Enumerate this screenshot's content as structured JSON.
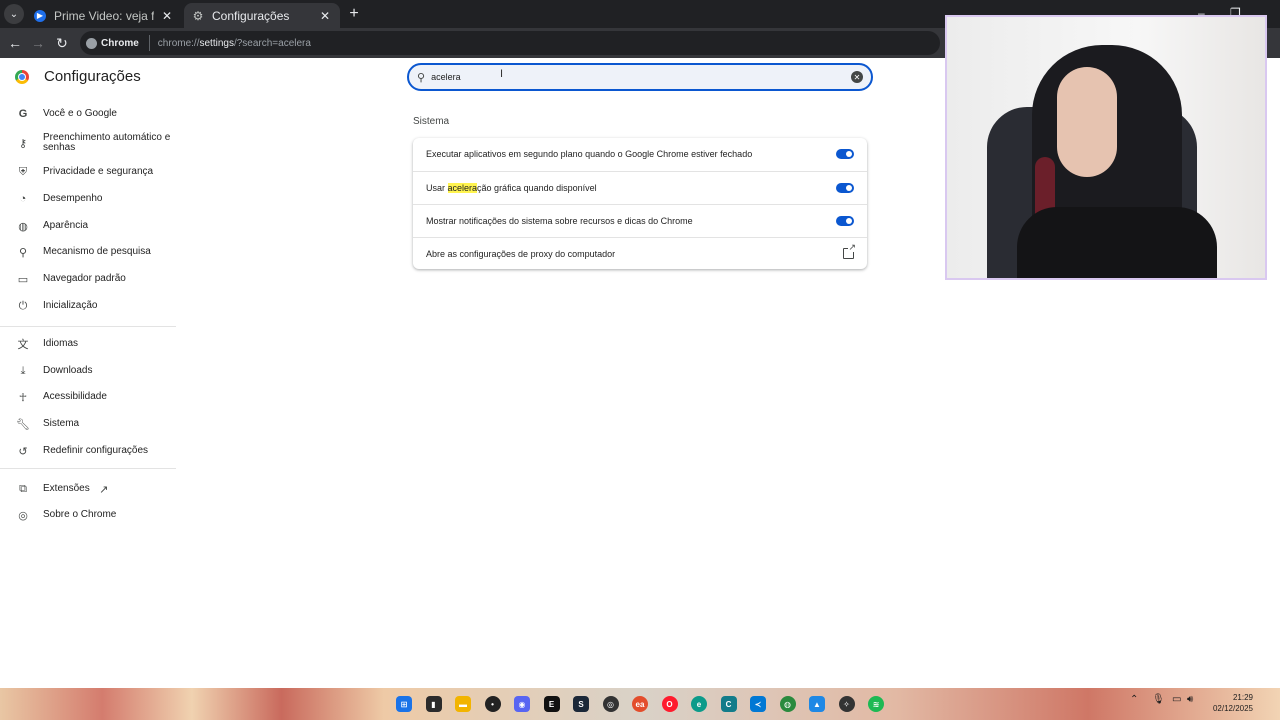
{
  "browser": {
    "tabs": [
      {
        "title": "Prime Video: veja filmes, séries,",
        "active": false
      },
      {
        "title": "Configurações",
        "active": true
      }
    ],
    "chip_label": "Chrome",
    "url_prefix": "chrome://",
    "url_host": "settings",
    "url_rest": "/?search=acelera"
  },
  "settings": {
    "title": "Configurações",
    "nav": [
      {
        "label": "Você e o Google",
        "icon": "google-g-icon"
      },
      {
        "label": "Preenchimento automático e senhas",
        "icon": "key-icon"
      },
      {
        "label": "Privacidade e segurança",
        "icon": "shield-icon"
      },
      {
        "label": "Desempenho",
        "icon": "speedometer-icon"
      },
      {
        "label": "Aparência",
        "icon": "palette-icon"
      },
      {
        "label": "Mecanismo de pesquisa",
        "icon": "search-icon"
      },
      {
        "label": "Navegador padrão",
        "icon": "browser-window-icon"
      },
      {
        "label": "Inicialização",
        "icon": "power-icon"
      },
      {
        "label": "Idiomas",
        "icon": "translate-icon"
      },
      {
        "label": "Downloads",
        "icon": "download-icon"
      },
      {
        "label": "Acessibilidade",
        "icon": "accessibility-icon"
      },
      {
        "label": "Sistema",
        "icon": "wrench-icon"
      },
      {
        "label": "Redefinir configurações",
        "icon": "reset-icon"
      },
      {
        "label": "Extensões",
        "icon": "puzzle-icon"
      },
      {
        "label": "Sobre o Chrome",
        "icon": "chrome-icon"
      }
    ],
    "search": {
      "value": "acelera"
    },
    "section_title": "Sistema",
    "rows": [
      {
        "label": "Executar aplicativos em segundo plano quando o Google Chrome estiver fechado",
        "control": "toggle",
        "on": true
      },
      {
        "label_before": "Usar ",
        "label_highlight": "acelera",
        "label_after": "ção gráfica quando disponível",
        "control": "toggle",
        "on": true
      },
      {
        "label": "Mostrar notificações do sistema sobre recursos e dicas do Chrome",
        "control": "toggle",
        "on": true
      },
      {
        "label": "Abre as configurações de proxy do computador",
        "control": "external-link"
      }
    ]
  },
  "taskbar": {
    "time": "21:29",
    "date": "02/12/2025",
    "apps": [
      "windows-start-icon",
      "file-explorer-icon",
      "folder-icon",
      "app-icon",
      "discord-icon",
      "epic-games-icon",
      "steam-icon",
      "ubisoft-icon",
      "ea-icon",
      "opera-icon",
      "edge-icon",
      "photoshop-icon",
      "vscode-icon",
      "chrome-icon",
      "photos-icon",
      "browser-icon",
      "steam-alt-icon",
      "spotify-icon"
    ]
  },
  "colors": {
    "accent": "#0b57d0",
    "highlight": "#fff44f"
  }
}
